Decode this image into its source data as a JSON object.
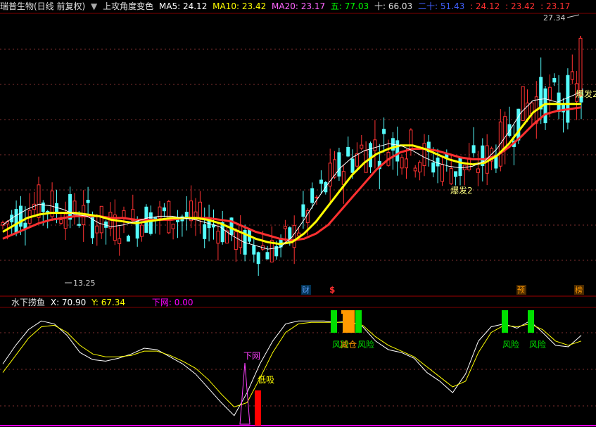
{
  "header": {
    "stock": "瑞普生物(日线 前复权)",
    "dropdown_icon": "chevron-down-circle-icon",
    "indicator": "上攻角度变色",
    "ma5": "MA5: 24.12",
    "ma10": "MA10: 23.42",
    "ma20": "MA20: 23.17",
    "wu": "五: 77.03",
    "shi": "十: 66.03",
    "ershi": "二十: 51.43",
    "v1": ": 24.12",
    "v2": ": 23.42",
    "v3": ": 23.17"
  },
  "sub_header": {
    "name": "水下捞鱼",
    "x": "X: 70.90",
    "y": "Y: 67.34",
    "xiawang": "下网: 0.00"
  },
  "colors": {
    "up": "#ff3232",
    "down": "#54fcfc",
    "ma5": "#ffffff",
    "ma10": "#ffff00",
    "ma20": "#ff3030",
    "risk": "#00e000",
    "jianc": "#ff9900",
    "purple": "#ff00ff"
  },
  "chart_data": [
    {
      "type": "candlestick",
      "price_range": [
        12.4,
        28.6
      ],
      "high_label": "27.34",
      "low_label": "13.25",
      "annotations": [
        "爆发2",
        "爆发2"
      ],
      "markers": [
        "财",
        "$",
        "预",
        "榜"
      ],
      "series": [
        {
          "name": "MA5",
          "values": [
            16.4,
            16.9,
            17.3,
            17.6,
            17.5,
            17.3,
            17.0,
            16.9,
            16.5,
            16.3,
            16.4,
            16.6,
            16.8,
            16.9,
            16.9,
            16.8,
            16.7,
            16.5,
            16.3,
            15.8,
            15.4,
            15.2,
            15.0,
            15.1,
            15.7,
            16.7,
            17.8,
            18.8,
            19.7,
            20.3,
            20.7,
            20.9,
            21.1,
            21.0,
            20.7,
            20.3,
            20.0,
            19.8,
            19.7,
            19.8,
            20.1,
            20.8,
            21.8,
            22.9,
            23.6,
            23.7,
            23.5,
            23.8,
            24.1
          ]
        },
        {
          "name": "MA10",
          "values": [
            16.0,
            16.4,
            16.8,
            17.0,
            17.1,
            17.1,
            17.1,
            17.0,
            16.9,
            16.7,
            16.6,
            16.5,
            16.6,
            16.7,
            16.8,
            16.8,
            16.8,
            16.7,
            16.5,
            16.2,
            15.9,
            15.6,
            15.4,
            15.3,
            15.4,
            15.9,
            16.6,
            17.5,
            18.4,
            19.3,
            20.0,
            20.5,
            20.8,
            21.0,
            21.0,
            20.8,
            20.5,
            20.2,
            20.0,
            19.9,
            20.0,
            20.4,
            21.1,
            22.0,
            22.9,
            23.4,
            23.4,
            23.4,
            23.4
          ]
        },
        {
          "name": "MA20",
          "values": [
            15.6,
            15.9,
            16.2,
            16.5,
            16.7,
            16.8,
            16.9,
            16.9,
            16.9,
            16.8,
            16.8,
            16.7,
            16.7,
            16.7,
            16.7,
            16.8,
            16.8,
            16.8,
            16.7,
            16.6,
            16.3,
            16.0,
            15.8,
            15.6,
            15.5,
            15.6,
            15.9,
            16.4,
            17.2,
            18.0,
            18.8,
            19.6,
            20.2,
            20.6,
            20.8,
            20.8,
            20.7,
            20.5,
            20.3,
            20.2,
            20.2,
            20.4,
            20.9,
            21.5,
            22.2,
            22.8,
            23.0,
            23.1,
            23.2
          ]
        }
      ]
    },
    {
      "type": "line",
      "x_current": 70.9,
      "y_current": 67.34,
      "series": [
        {
          "name": "X",
          "values": [
            42,
            55,
            66,
            72,
            70,
            62,
            50,
            45,
            44,
            46,
            49,
            53,
            52,
            47,
            42,
            35,
            25,
            15,
            6,
            22,
            42,
            58,
            70,
            72,
            72,
            72,
            71,
            72,
            68,
            58,
            52,
            50,
            46,
            36,
            30,
            22,
            35,
            58,
            68,
            70,
            67,
            72,
            64,
            55,
            54,
            62
          ]
        },
        {
          "name": "Y",
          "values": [
            36,
            48,
            60,
            68,
            69,
            64,
            55,
            49,
            47,
            47,
            48,
            51,
            51,
            48,
            44,
            39,
            31,
            21,
            12,
            15,
            32,
            50,
            64,
            70,
            71,
            71,
            71,
            71,
            69,
            61,
            55,
            51,
            47,
            40,
            33,
            26,
            30,
            50,
            64,
            69,
            68,
            70,
            66,
            58,
            55,
            58
          ]
        }
      ],
      "signals": [
        "下网",
        "低吸",
        "风险",
        "减仓",
        "风险",
        "风险",
        "风险"
      ]
    }
  ]
}
